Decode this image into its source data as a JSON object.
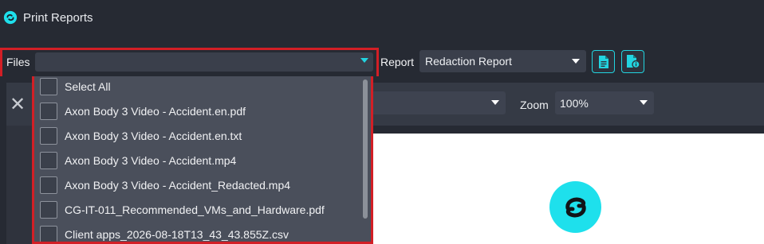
{
  "window": {
    "title": "Print Reports",
    "logo_icon": "swirl-logo-icon"
  },
  "files": {
    "label": "Files",
    "value": "",
    "options": [
      "Select All",
      "Axon Body 3 Video - Accident.en.pdf",
      "Axon Body 3 Video - Accident.en.txt",
      "Axon Body 3 Video - Accident.mp4",
      "Axon Body 3 Video - Accident_Redacted.mp4",
      "CG-IT-011_Recommended_VMs_and_Hardware.pdf",
      "Client apps_2026-08-18T13_43_43.855Z.csv"
    ]
  },
  "report": {
    "label": "Report",
    "value": "Redaction Report",
    "buttons": [
      "document-icon",
      "document-info-icon"
    ]
  },
  "viewer": {
    "close_icon": "close-icon",
    "page_value": "",
    "zoom_label": "Zoom",
    "zoom_value": "100%"
  },
  "colors": {
    "accent": "#22d4e0",
    "highlight": "#d21f26",
    "background": "#262a33"
  }
}
